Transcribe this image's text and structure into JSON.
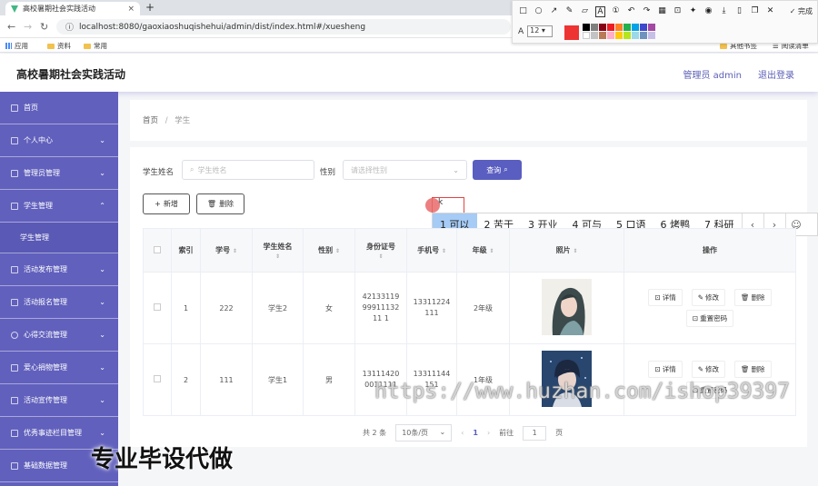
{
  "browser": {
    "tab_title": "高校暑期社会实践活动",
    "tab_close": "×",
    "new_tab": "+",
    "url": "localhost:8080/gaoxiaoshuqishehui/admin/dist/index.html#/xuesheng",
    "bookmarks": [
      "应用",
      "资料",
      "常用"
    ],
    "bookmarks_right": [
      "其他书签",
      "阅读清单"
    ]
  },
  "annotation_toolbar": {
    "done_label": "完成",
    "font_label": "A",
    "font_size": "12",
    "current_color": "#ee3333",
    "palette": [
      "#000000",
      "#7f7f7f",
      "#880015",
      "#ed1c24",
      "#ff7f27",
      "#22b14c",
      "#00a2e8",
      "#3f48cc",
      "#a349a4",
      "#ffffff",
      "#c3c3c3",
      "#b97a57",
      "#ffaec9",
      "#ffc90e",
      "#b5e61d",
      "#99d9ea",
      "#7092be",
      "#c8bfe7"
    ]
  },
  "header": {
    "app_title": "高校暑期社会实践活动",
    "user_label": "管理员 admin",
    "logout_label": "退出登录"
  },
  "sidebar": {
    "items": [
      {
        "label": "首页",
        "chevron": ""
      },
      {
        "label": "个人中心",
        "chevron": "⌄"
      },
      {
        "label": "管理员管理",
        "chevron": "⌄"
      },
      {
        "label": "学生管理",
        "chevron": "⌃"
      },
      {
        "label": "学生管理",
        "sub": true
      },
      {
        "label": "活动发布管理",
        "chevron": "⌄"
      },
      {
        "label": "活动报名管理",
        "chevron": "⌄"
      },
      {
        "label": "心得交流管理",
        "chevron": "⌄"
      },
      {
        "label": "爱心捐物管理",
        "chevron": "⌄"
      },
      {
        "label": "活动宣传管理",
        "chevron": "⌄"
      },
      {
        "label": "优秀事迹栏目管理",
        "chevron": "⌄"
      },
      {
        "label": "基础数据管理",
        "chevron": "⌄"
      }
    ]
  },
  "breadcrumb": {
    "home": "首页",
    "sep": "/",
    "current": "学生"
  },
  "search": {
    "name_label": "学生姓名",
    "name_placeholder": "学生姓名",
    "gender_label": "性别",
    "gender_placeholder": "请选择性别",
    "query_label": "查询"
  },
  "actions": {
    "add_label": "新增",
    "delete_label": "删除"
  },
  "ime": {
    "candidates": [
      "1 可以",
      "2 苦于",
      "3 开业",
      "4 可与",
      "5 口语",
      "6 烤鸭",
      "7 科研"
    ],
    "typed": "k"
  },
  "table": {
    "headers": [
      "索引",
      "学号",
      "学生姓名",
      "性别",
      "身份证号",
      "手机号",
      "年级",
      "照片",
      "操作"
    ],
    "rows": [
      {
        "index": "1",
        "xuehao": "222",
        "name": "学生2",
        "gender": "女",
        "idcard": "421331199991113211 1",
        "phone": "13311224111",
        "grade": "2年级"
      },
      {
        "index": "2",
        "xuehao": "111",
        "name": "学生1",
        "gender": "男",
        "idcard": "131114200011111",
        "phone": "13311144151",
        "grade": "1年级"
      }
    ],
    "ops": {
      "detail": "详情",
      "edit": "修改",
      "delete": "删除",
      "reset": "重置密码"
    }
  },
  "pagination": {
    "total": "共 2 条",
    "page_size": "10条/页",
    "current": "1",
    "goto_label": "前往",
    "goto_value": "1",
    "page_unit": "页"
  },
  "overlays": {
    "watermark": "https://www.huzhan.com/ishop39397",
    "promo": "专业毕设代做"
  }
}
